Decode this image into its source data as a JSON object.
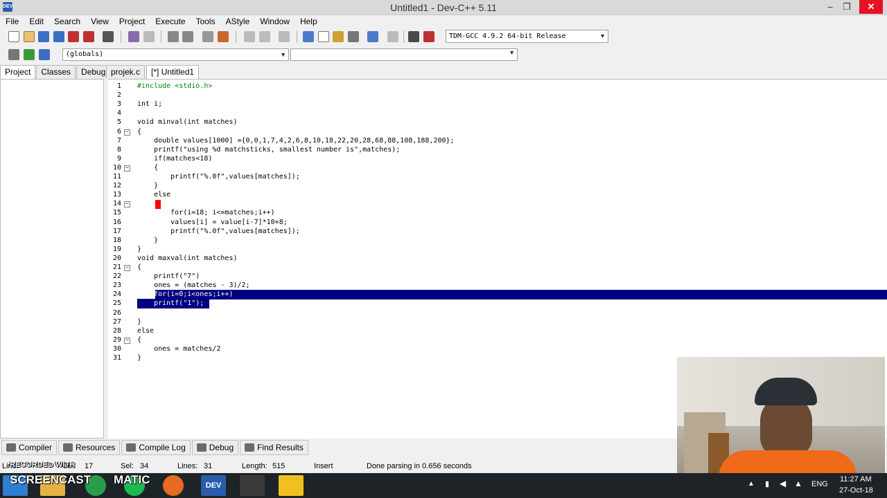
{
  "window": {
    "title": "Untitled1 - Dev-C++ 5.11",
    "app_icon_text": "DEV",
    "minimize": "–",
    "maximize": "❐",
    "close": "✕"
  },
  "menu": [
    "File",
    "Edit",
    "Search",
    "View",
    "Project",
    "Execute",
    "Tools",
    "AStyle",
    "Window",
    "Help"
  ],
  "toolbar": {
    "compiler": "TDM-GCC 4.9.2 64-bit Release",
    "scope": "(globals)",
    "accent": "#2a5cab"
  },
  "left_tabs": [
    "Project",
    "Classes",
    "Debug"
  ],
  "editor_tabs": [
    "projek.c",
    "[*] Untitled1"
  ],
  "code_lines": [
    "#include <stdio.h>",
    "",
    "int i;",
    "",
    "void minval(int matches)",
    "{",
    "    double values[1000] ={0,0,1,7,4,2,6,8,10,18,22,20,28,68,88,108,188,200};",
    "    printf(\"using %d matchsticks, smallest number is\",matches);",
    "    if(matches<18)",
    "    {",
    "        printf(\"%.0f\",values[matches]);",
    "    }",
    "    else",
    "    {",
    "        for(i=18; i<=matches;i++)",
    "        values[i] = value[i-7]*10+8;",
    "        printf(\"%.0f\",values[matches]);",
    "    }",
    "}",
    "void maxval(int matches)",
    "{",
    "    printf(\"7\")",
    "    ones = (matches - 3)/2;",
    "    for(i=0;i<ones;i++)",
    "    printf(\"1\");",
    "",
    "}",
    "else",
    "{",
    "    ones = matches/2",
    "}"
  ],
  "line_numbers": [
    "1",
    "2",
    "3",
    "4",
    "5",
    "6",
    "7",
    "8",
    "9",
    "10",
    "11",
    "12",
    "13",
    "14",
    "15",
    "16",
    "17",
    "18",
    "19",
    "20",
    "21",
    "22",
    "23",
    "24",
    "25",
    "26",
    "27",
    "28",
    "29",
    "30",
    "31"
  ],
  "bottom_tabs": [
    "Compiler",
    "Resources",
    "Compile Log",
    "Debug",
    "Find Results"
  ],
  "status": {
    "line_label": "Line:",
    "line": "17",
    "col_label": "Col:",
    "sel_label": "Sel:",
    "sel": "34",
    "lines_label": "Lines:",
    "lines": "31",
    "length_label": "Length:",
    "length": "515",
    "mode": "Insert",
    "message": "Done parsing in 0.656 seconds"
  },
  "watermark": {
    "recorded": "RECORDED WITH",
    "brand": "SCREENCAST",
    "brand2": "MATIC"
  },
  "taskbar": {
    "lang": "ENG",
    "time": "11:27 AM",
    "date": "27-Oct-18",
    "dev_label": "DEV"
  }
}
